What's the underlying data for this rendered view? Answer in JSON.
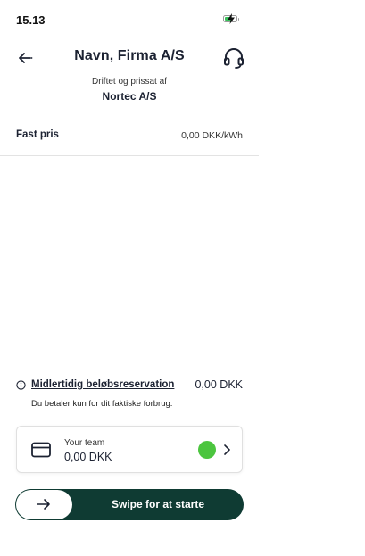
{
  "status_bar": {
    "time": "15.13",
    "battery_icon": "battery-charging-icon",
    "battery_color": "#38c05a",
    "battery_level": 0.6
  },
  "header": {
    "back_icon": "arrow-left-icon",
    "title": "Navn, Firma A/S",
    "support_icon": "headset-icon",
    "operator_label": "Driftet og prissat af",
    "operator_name": "Nortec A/S"
  },
  "pricing": {
    "label": "Fast pris",
    "value": "0,00 DKK/kWh"
  },
  "reservation": {
    "icon": "info-icon",
    "label": "Midlertidig beløbsreservation",
    "amount": "0,00 DKK",
    "note": "Du betaler kun for dit faktiske forbrug."
  },
  "payment": {
    "icon": "credit-card-icon",
    "team_name": "Your team",
    "balance": "0,00 DKK",
    "status_color": "#4cc53f",
    "chevron_icon": "chevron-right-icon"
  },
  "swipe": {
    "label": "Swipe for at starte",
    "arrow_icon": "arrow-right-icon",
    "track_color": "#0f3b33"
  }
}
